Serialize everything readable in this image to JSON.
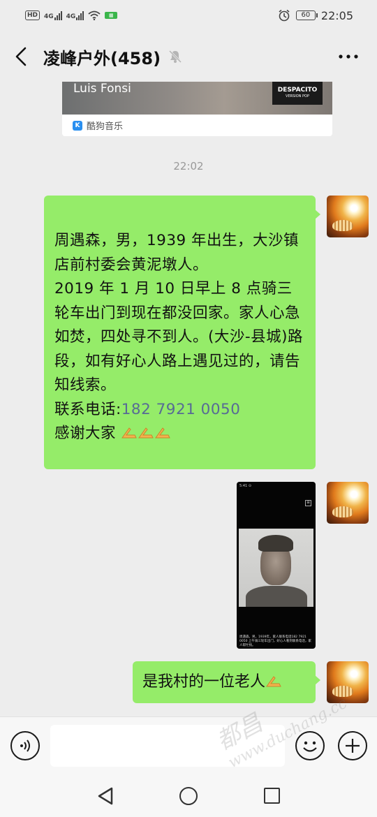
{
  "status_bar": {
    "hd_badge": "HD",
    "network_1": "4G",
    "network_2": "4G",
    "battery": "60",
    "time": "22:05",
    "icons": [
      "signal-icon",
      "wifi-icon",
      "alarm-icon",
      "battery-icon"
    ]
  },
  "header": {
    "title": "凌峰户外(458)",
    "icons": [
      "back-arrow-icon",
      "mute-bell-icon",
      "more-dots-icon"
    ]
  },
  "messages": {
    "music_card": {
      "artist": "Luis Fonsi",
      "cover_title": "DESPACITO",
      "cover_subtitle": "VERSION POP",
      "source": "酷狗音乐",
      "source_icon_letter": "K"
    },
    "timestamp": "22:02",
    "text_message": {
      "line1": "周遇森，男，1939 年出生，大沙镇店前村委会黄泥墩人。",
      "line2": "2019 年 1 月 10 日早上 8 点骑三轮车出门到现在都没回家。家人心急如焚，四处寻不到人。(大沙-县城)路段，如有好心人路上遇见过的，请告知线索。",
      "contact_label": "联系电话:",
      "phone": "182 7921 0050",
      "thanks": "感谢大家"
    },
    "image_message": {
      "topbar": "5:41 ⊙",
      "menu": "⊞",
      "caption": "周遇森，男，1939年，家人联系电话182 7921 0050 上午骑三轮车出门，好心人看到联系电话，家人帮忙找。"
    },
    "short_message": {
      "text": "是我村的一位老人"
    }
  },
  "input_bar": {
    "icons": [
      "voice-icon",
      "emoji-icon",
      "plus-icon"
    ]
  },
  "nav_bar": {
    "icons": [
      "nav-back-icon",
      "nav-home-icon",
      "nav-recent-icon"
    ]
  },
  "watermark": {
    "line1": "都昌",
    "line2": "www.duchang.cc"
  },
  "colors": {
    "bubble_green": "#95ec69",
    "link_blue": "#576b95",
    "background": "#ededed"
  }
}
